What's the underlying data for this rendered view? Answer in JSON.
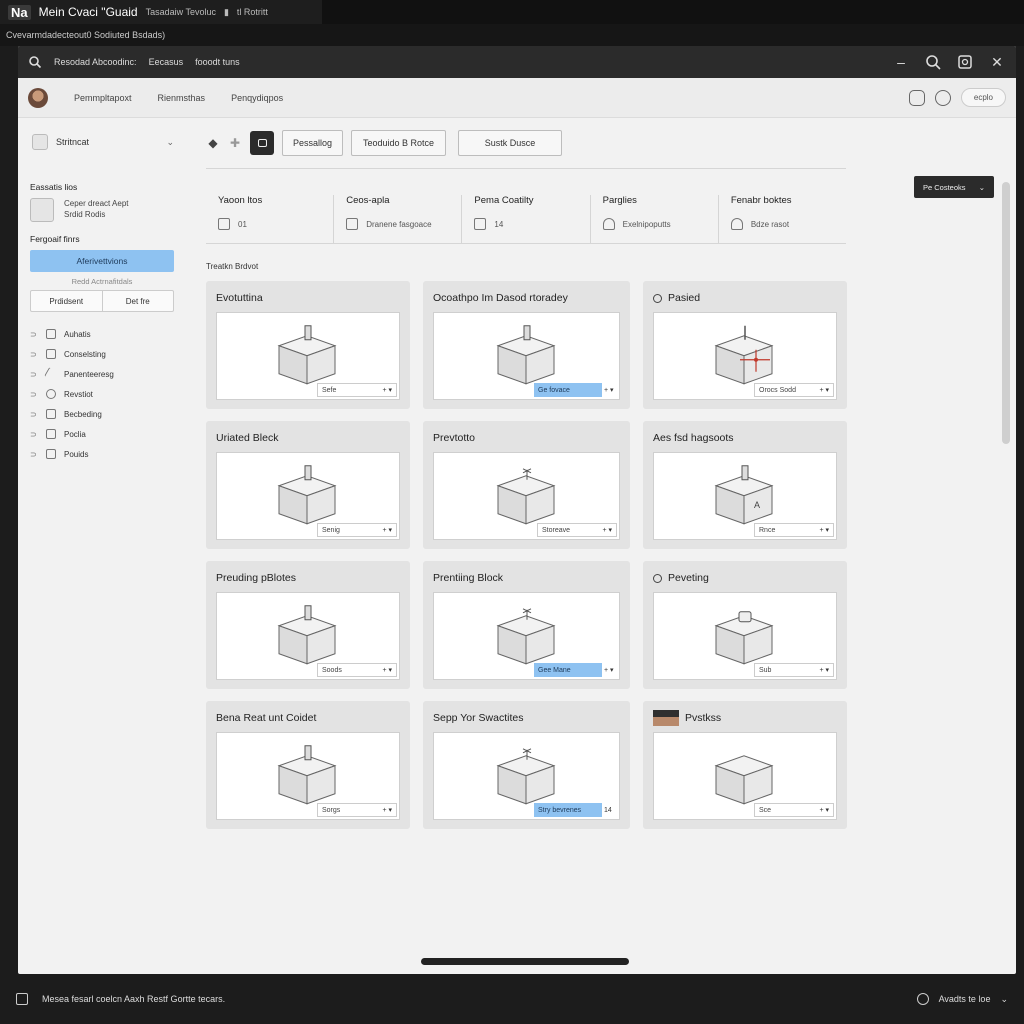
{
  "os": {
    "logo": "Na",
    "title": "Mein Cvaci \"Guaid",
    "subtitle": "Tasadaiw  Tevoluc",
    "extra": "tl Rotritt",
    "status_line": "Cvevarmdadecteout0 Sodiuted Bsdads)"
  },
  "window": {
    "tabs": [
      "Resodad Abcoodinc:",
      "Eecasus",
      "fooodt tuns"
    ]
  },
  "topnav": {
    "items": [
      "Pemmpltapoxt",
      "Rienmsthas",
      "Penqydiqpos"
    ],
    "pill": "ecplo"
  },
  "sidebar": {
    "header": "Stritncat",
    "section1": "Eassatis lios",
    "card_text": [
      "Ceper dreact Aept",
      "Srdid Rodis"
    ],
    "section2": "Fergoaif finrs",
    "primary_button": "Aferivettvions",
    "hint": "Redd Actrnafitdals",
    "split": [
      "Prdidsent",
      "Det fre"
    ],
    "items": [
      "Auhatis",
      "Conselsting",
      "Panenteeresg",
      "Revstiot",
      "Becbeding",
      "Poclia",
      "Pouids"
    ]
  },
  "toolbar": {
    "buttons": [
      "Pessallog",
      "Teoduido B Rotce",
      "Sustk Dusce"
    ]
  },
  "stats": [
    {
      "title": "Yaoon ltos",
      "value": "01"
    },
    {
      "title": "Ceos-apla",
      "value": "Dranene fasgoace"
    },
    {
      "title": "Pema Coatilty",
      "value": "14"
    },
    {
      "title": "Parglies",
      "value": "Exelnipoputts"
    },
    {
      "title": "Fenabr boktes",
      "value": "Bdze rasot"
    }
  ],
  "section_label": "Treatkn Brdvot",
  "right_dropdown": "Pe Costeoks",
  "cards": [
    {
      "title": "Evotuttina",
      "select": "Sefe",
      "blue": "",
      "tail": ""
    },
    {
      "title": "Ocoathpo Im Dasod rtoradey",
      "select": "",
      "blue": "Ge fovace",
      "tail": "+ ▾"
    },
    {
      "title": "Pasied",
      "select": "Orocs Sodd",
      "blue": "",
      "tail": ""
    },
    {
      "title": "Uriated Bleck",
      "select": "Senig",
      "blue": "",
      "tail": ""
    },
    {
      "title": "Prevtotto",
      "select": "Storeave",
      "blue": "",
      "tail": ""
    },
    {
      "title": "Aes fsd hagsoots",
      "select": "Rnce",
      "blue": "",
      "tail": ""
    },
    {
      "title": "Preuding pBlotes",
      "select": "Soods",
      "blue": "",
      "tail": ""
    },
    {
      "title": "Prentiing Block",
      "select": "",
      "blue": "Gee Mane",
      "tail": "+ ▾"
    },
    {
      "title": "Peveting",
      "select": "Sub",
      "blue": "",
      "tail": ""
    },
    {
      "title": "Bena Reat unt Coidet",
      "select": "Sorgs",
      "blue": "",
      "tail": ""
    },
    {
      "title": "Sepp Yor Swactites",
      "select": "",
      "blue": "Stry bevrenes",
      "tail": "14"
    },
    {
      "title": "Pvstkss",
      "select": "Sce",
      "blue": "",
      "tail": ""
    }
  ],
  "bottom": {
    "message": "Mesea fesarl coelcn Aaxh Restf Gortte tecars.",
    "right_label": "Avadts te loe"
  }
}
